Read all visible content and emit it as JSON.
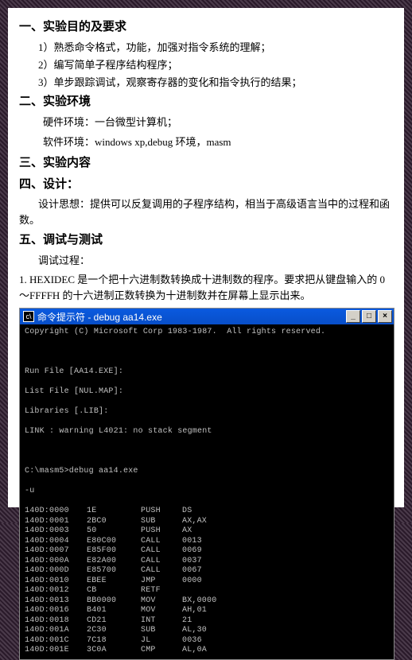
{
  "sections": {
    "s1_title": "一、实验目的及要求",
    "s1_items": {
      "i1": "1）熟悉命令格式，功能，加强对指令系统的理解；",
      "i2": "2）编写简单子程序结构程序；",
      "i3": "3）单步跟踪调试，观察寄存器的变化和指令执行的结果；"
    },
    "s2_title": "二、实验环境",
    "s2_hw": "硬件环境：一台微型计算机；",
    "s2_sw": "软件环境：windows xp,debug 环境，masm",
    "s3_title": "三、实验内容",
    "s4_title": "四、设计：",
    "s4_para": "设计思想：提供可以反复调用的子程序结构，相当于高级语言当中的过程和函数。",
    "s5_title": "五、调试与测试",
    "s5_sub": "调试过程：",
    "hexidec": "1. HEXIDEC 是一个把十六进制数转换成十进制数的程序。要求把从键盘输入的 0～FFFFH 的十六进制正数转换为十进制数并在屏幕上显示出来。"
  },
  "terminal": {
    "title": "命令提示符 - debug aa14.exe",
    "copyright": "Copyright (C) Microsoft Corp 1983-1987.  All rights reserved.",
    "lines": {
      "l1": "Run File [AA14.EXE]:",
      "l2": "List File [NUL.MAP]:",
      "l3": "Libraries [.LIB]:",
      "l4": "LINK : warning L4021: no stack segment",
      "l5": "C:\\masm5>debug aa14.exe",
      "l6": "-u"
    },
    "disasm": [
      {
        "addr": "140D:0000",
        "bytes": "1E",
        "mn": "PUSH",
        "op": "DS"
      },
      {
        "addr": "140D:0001",
        "bytes": "2BC0",
        "mn": "SUB",
        "op": "AX,AX"
      },
      {
        "addr": "140D:0003",
        "bytes": "50",
        "mn": "PUSH",
        "op": "AX"
      },
      {
        "addr": "140D:0004",
        "bytes": "E80C00",
        "mn": "CALL",
        "op": "0013"
      },
      {
        "addr": "140D:0007",
        "bytes": "E85F00",
        "mn": "CALL",
        "op": "0069"
      },
      {
        "addr": "140D:000A",
        "bytes": "E82A00",
        "mn": "CALL",
        "op": "0037"
      },
      {
        "addr": "140D:000D",
        "bytes": "E85700",
        "mn": "CALL",
        "op": "0067"
      },
      {
        "addr": "140D:0010",
        "bytes": "EBEE",
        "mn": "JMP",
        "op": "0000"
      },
      {
        "addr": "140D:0012",
        "bytes": "CB",
        "mn": "RETF",
        "op": ""
      },
      {
        "addr": "140D:0013",
        "bytes": "BB0000",
        "mn": "MOV",
        "op": "BX,0000"
      },
      {
        "addr": "140D:0016",
        "bytes": "B401",
        "mn": "MOV",
        "op": "AH,01"
      },
      {
        "addr": "140D:0018",
        "bytes": "CD21",
        "mn": "INT",
        "op": "21"
      },
      {
        "addr": "140D:001A",
        "bytes": "2C30",
        "mn": "SUB",
        "op": "AL,30"
      },
      {
        "addr": "140D:001C",
        "bytes": "7C18",
        "mn": "JL",
        "op": "0036"
      },
      {
        "addr": "140D:001E",
        "bytes": "3C0A",
        "mn": "CMP",
        "op": "AL,0A"
      }
    ]
  }
}
